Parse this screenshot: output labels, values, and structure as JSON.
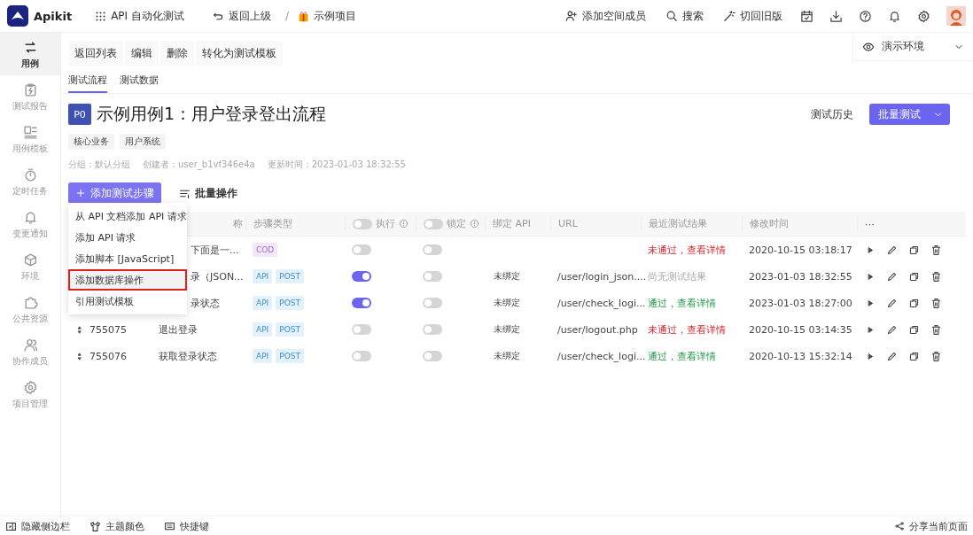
{
  "topbar": {
    "brand": "Apikit",
    "module": "API 自动化测试",
    "back": "返回上级",
    "separator": "/",
    "project": "示例项目",
    "actions": [
      {
        "kind": "member",
        "label": "添加空间成员"
      },
      {
        "kind": "search",
        "label": "搜索"
      },
      {
        "kind": "wand",
        "label": "切回旧版"
      }
    ]
  },
  "sidebar": {
    "items": [
      {
        "kind": "flow",
        "label": "用例",
        "selected": true
      },
      {
        "kind": "report",
        "label": "测试报告",
        "selected": false
      },
      {
        "kind": "template",
        "label": "用例模板",
        "selected": false
      },
      {
        "kind": "timer",
        "label": "定时任务",
        "selected": false
      },
      {
        "kind": "bell",
        "label": "变更通知",
        "selected": false
      },
      {
        "kind": "cube",
        "label": "环境",
        "selected": false
      },
      {
        "kind": "puzzle",
        "label": "公共资源",
        "selected": false
      },
      {
        "kind": "users",
        "label": "协作成员",
        "selected": false
      },
      {
        "kind": "gear",
        "label": "项目管理",
        "selected": false
      }
    ]
  },
  "toolbar": [
    "返回列表",
    "编辑",
    "删除",
    "转化为测试模板"
  ],
  "environment": "演示环境",
  "tabs": [
    {
      "label": "测试流程",
      "selected": true
    },
    {
      "label": "测试数据",
      "selected": false
    }
  ],
  "case": {
    "priority": "P0",
    "title": "示例用例1：用户登录登出流程",
    "history": "测试历史",
    "run": "批量测试",
    "tags": [
      "核心业务",
      "用户系统"
    ],
    "meta": [
      "分组：默认分组",
      "创建者：user_b1vf346e4a",
      "更新时间：2023-01-03 18:32:55"
    ]
  },
  "add_step": "添加测试步骤",
  "batch": "批量操作",
  "menu": [
    {
      "label": "从 API 文档添加 API 请求",
      "selected": false
    },
    {
      "label": "添加 API 请求",
      "selected": false
    },
    {
      "label": "添加脚本 [JavaScript]",
      "selected": false
    },
    {
      "label": "添加数据库操作",
      "selected": true
    },
    {
      "label": "引用测试模板",
      "selected": false
    }
  ],
  "table": {
    "columns": {
      "name": "称",
      "type": "步骤类型",
      "exec": "执行",
      "lock": "锁定",
      "bind": "绑定 API",
      "url": "URL",
      "result": "最近测试结果",
      "time": "修改时间",
      "more": "···"
    },
    "exec_all": false,
    "lock_all": false,
    "rows": [
      {
        "name": "下面是一...",
        "tags": [
          {
            "kind": "code",
            "label": "COD"
          }
        ],
        "exec": false,
        "lock": false,
        "result": {
          "kind": "fail",
          "label": "未通过，查看详情"
        },
        "time": "2020-10-15 03:18:17"
      },
      {
        "name": "录（JSON...",
        "tags": [
          {
            "kind": "api",
            "label": "API"
          },
          {
            "kind": "api",
            "label": "POST"
          }
        ],
        "exec": true,
        "lock": false,
        "bind": "未绑定",
        "url": "/user/login_json....",
        "result": {
          "kind": "none",
          "label": "尚无测试结果"
        },
        "time": "2023-01-03 18:32:55"
      },
      {
        "name": "录状态",
        "tags": [
          {
            "kind": "api",
            "label": "API"
          },
          {
            "kind": "api",
            "label": "POST"
          }
        ],
        "exec": true,
        "lock": false,
        "bind": "未绑定",
        "url": "/user/check_logi...",
        "result": {
          "kind": "pass",
          "label": "通过，查看详情"
        },
        "time": "2023-01-03 18:27:00"
      },
      {
        "id": "755075",
        "name": "退出登录",
        "tags": [
          {
            "kind": "api",
            "label": "API"
          },
          {
            "kind": "api",
            "label": "POST"
          }
        ],
        "exec": false,
        "lock": false,
        "bind": "未绑定",
        "url": "/user/logout.php",
        "result": {
          "kind": "fail",
          "label": "未通过，查看详情"
        },
        "time": "2020-10-15 03:14:35"
      },
      {
        "id": "755076",
        "name": "获取登录状态",
        "tags": [
          {
            "kind": "api",
            "label": "API"
          },
          {
            "kind": "api",
            "label": "POST"
          }
        ],
        "exec": false,
        "lock": false,
        "bind": "未绑定",
        "url": "/user/check_logi...",
        "result": {
          "kind": "pass",
          "label": "通过，查看详情"
        },
        "time": "2020-10-13 15:32:14"
      }
    ]
  },
  "footer": {
    "items": [
      {
        "kind": "sidebar",
        "label": "隐藏侧边栏"
      },
      {
        "kind": "shirt",
        "label": "主题颜色"
      },
      {
        "kind": "keyboard",
        "label": "快捷键"
      }
    ],
    "share": "分享当前页面"
  }
}
